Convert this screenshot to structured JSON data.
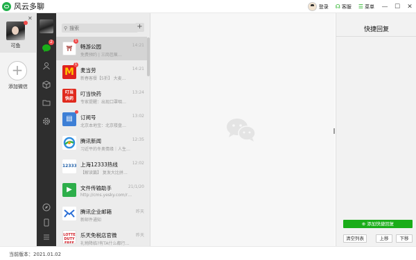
{
  "app": {
    "title": "风云多聊"
  },
  "header": {
    "login": "登录",
    "service": "客服",
    "menu": "菜单"
  },
  "accounts": {
    "name": "可鱼",
    "add_label": "添加微信"
  },
  "nav": {
    "chat_badge": "2"
  },
  "search": {
    "placeholder": "搜索"
  },
  "chats": [
    {
      "name": "畅游公园",
      "time": "14:21",
      "preview": "免费预约 | 三岗芭蕉…",
      "badge": "1"
    },
    {
      "name": "麦当劳",
      "time": "14:21",
      "preview": "新春客餐【5折】 大麦…",
      "badge": "1"
    },
    {
      "name": "叮当快药",
      "time": "13:24",
      "preview": "专家提醒：出现口罩咽…",
      "badge": ""
    },
    {
      "name": "订阅号",
      "time": "13:02",
      "preview": "北京本地宝：北京楼盘…",
      "badge": ""
    },
    {
      "name": "腾讯新闻",
      "time": "12:35",
      "preview": "习近平的冬奥情缘｜人生…",
      "badge": ""
    },
    {
      "name": "上海12333热线",
      "time": "12:02",
      "preview": "【解读篇】 复发大比拼…",
      "badge": ""
    },
    {
      "name": "文件传输助手",
      "time": "21/1/20",
      "preview": "http://cms.yesky.com/r…",
      "badge": ""
    },
    {
      "name": "腾讯企业邮箱",
      "time": "昨天",
      "preview": "新邮件通知",
      "badge": ""
    },
    {
      "name": "乐天免税店官微",
      "time": "昨天",
      "preview": "礼物降临?有TA什么都行…",
      "badge": ""
    }
  ],
  "quick_reply": {
    "title": "快捷回复",
    "add_button": "添加快捷回复",
    "clear_button": "清空列表",
    "up_button": "上移",
    "down_button": "下移"
  },
  "footer": {
    "version": "当前版本：2021.01.02"
  },
  "colors": {
    "accent": "#1aad19",
    "nav_bg": "#2e2e2e",
    "badge": "#f04b4b"
  }
}
